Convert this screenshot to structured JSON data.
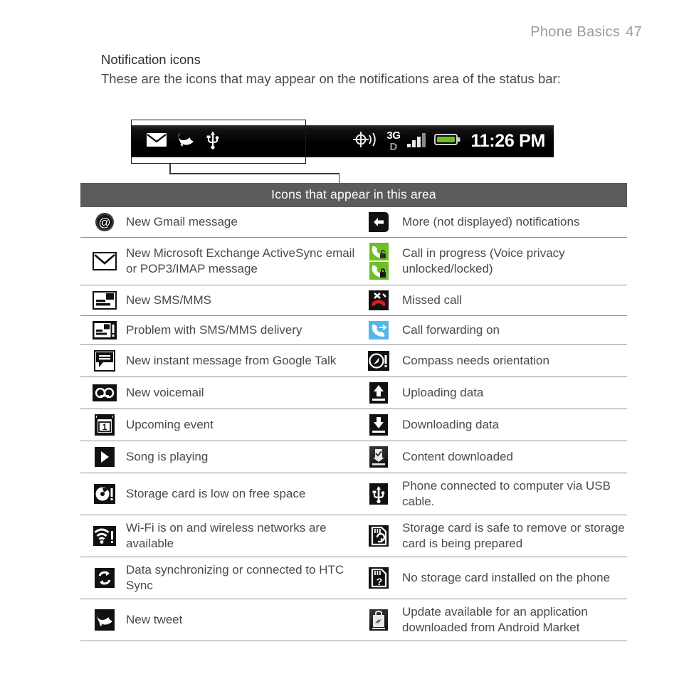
{
  "header": {
    "book_section": "Phone Basics",
    "page_number": "47"
  },
  "section": {
    "title": "Notification icons",
    "intro": "These are the icons that may appear on the notifications area of the status bar:"
  },
  "statusbar": {
    "left_icons": [
      "envelope-icon",
      "twitter-bird-icon",
      "usb-icon"
    ],
    "right_icons": [
      "gps-icon",
      "network-3g-d-icon",
      "signal-bars-icon",
      "battery-icon"
    ],
    "network_label_top": "3G",
    "network_label_bottom": "D",
    "clock": "11:26 PM",
    "background_color": "#000000",
    "battery_color": "#6fbe28"
  },
  "callout": {
    "label": "Icons that appear in this area"
  },
  "table": {
    "header": "Icons that appear in this area",
    "rows": [
      {
        "left": {
          "icon": "at-sign-icon",
          "label": "New Gmail message"
        },
        "right": {
          "icon": "more-notifications-icon",
          "label": "More (not displayed) notifications"
        }
      },
      {
        "left": {
          "icon": "mail-envelope-icon",
          "label": "New Microsoft Exchange ActiveSync email or POP3/IMAP message"
        },
        "right": {
          "icon": "call-in-progress-privacy-icon",
          "label": "Call in progress (Voice privacy unlocked/locked)"
        }
      },
      {
        "left": {
          "icon": "sms-message-icon",
          "label": "New SMS/MMS"
        },
        "right": {
          "icon": "missed-call-icon",
          "label": "Missed call"
        }
      },
      {
        "left": {
          "icon": "sms-problem-icon",
          "label": "Problem with SMS/MMS delivery"
        },
        "right": {
          "icon": "call-forwarding-icon",
          "label": "Call forwarding on"
        }
      },
      {
        "left": {
          "icon": "instant-message-icon",
          "label": "New instant message from Google Talk"
        },
        "right": {
          "icon": "compass-orientation-icon",
          "label": "Compass needs orientation"
        }
      },
      {
        "left": {
          "icon": "voicemail-icon",
          "label": "New voicemail"
        },
        "right": {
          "icon": "upload-icon",
          "label": "Uploading data"
        }
      },
      {
        "left": {
          "icon": "calendar-event-icon",
          "label": "Upcoming event"
        },
        "right": {
          "icon": "download-icon",
          "label": "Downloading data"
        }
      },
      {
        "left": {
          "icon": "music-play-icon",
          "label": "Song is playing"
        },
        "right": {
          "icon": "content-downloaded-icon",
          "label": "Content downloaded"
        }
      },
      {
        "left": {
          "icon": "storage-low-icon",
          "label": "Storage card is low on free space"
        },
        "right": {
          "icon": "usb-connected-icon",
          "label": "Phone connected to computer via USB cable."
        }
      },
      {
        "left": {
          "icon": "wifi-available-icon",
          "label": "Wi-Fi is on and wireless networks are available"
        },
        "right": {
          "icon": "sd-card-safe-icon",
          "label": "Storage card is safe to remove or storage card is being prepared"
        }
      },
      {
        "left": {
          "icon": "sync-icon",
          "label": "Data synchronizing or connected to HTC Sync"
        },
        "right": {
          "icon": "sd-card-missing-icon",
          "label": "No storage card installed on the phone"
        }
      },
      {
        "left": {
          "icon": "twitter-bird-icon",
          "label": "New tweet"
        },
        "right": {
          "icon": "app-update-icon",
          "label": "Update available for an application downloaded from Android Market"
        }
      }
    ]
  }
}
